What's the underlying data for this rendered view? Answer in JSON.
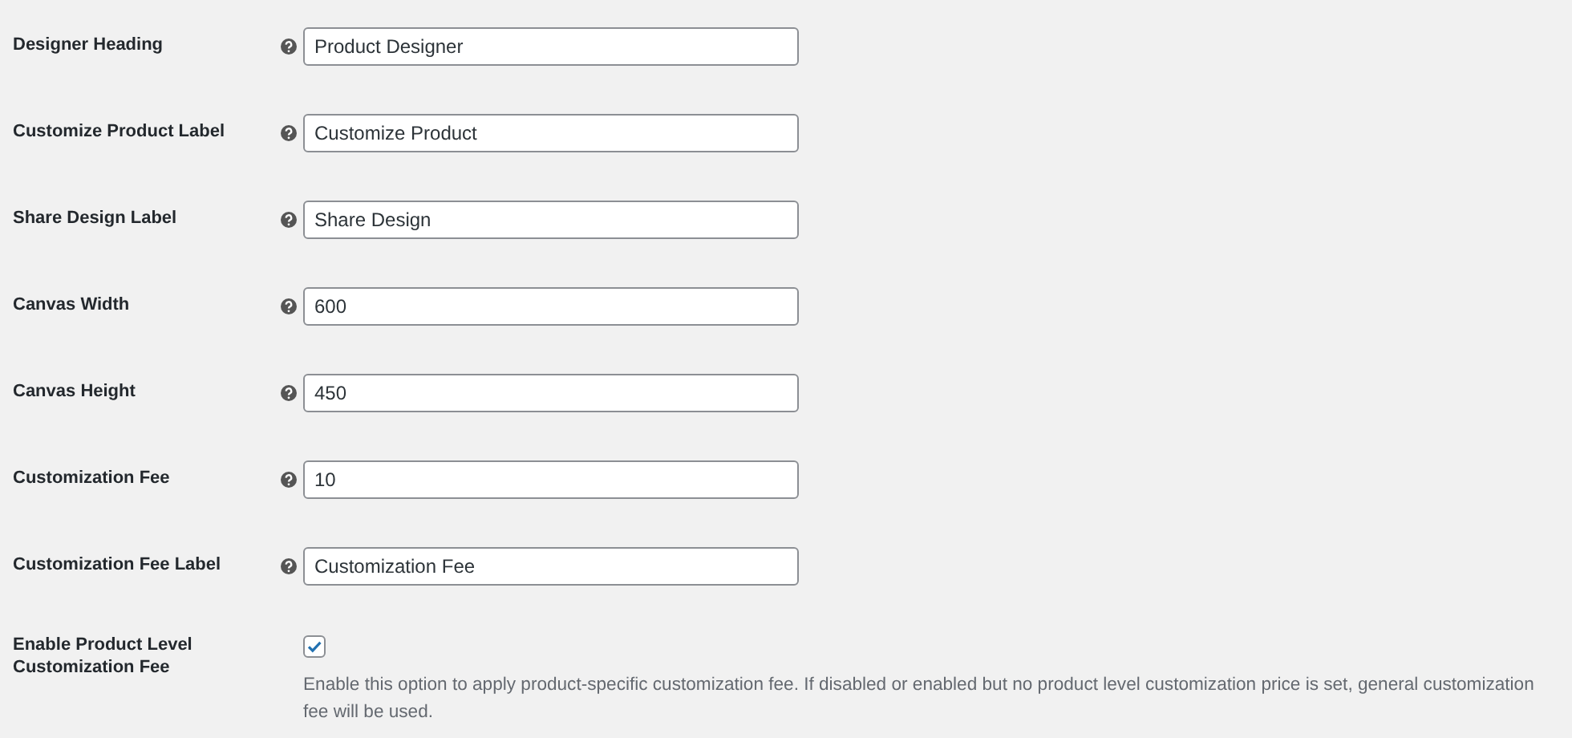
{
  "settings": [
    {
      "kind": "text",
      "label": "Designer Heading",
      "value": "Product Designer"
    },
    {
      "kind": "text",
      "label": "Customize Product Label",
      "value": "Customize Product"
    },
    {
      "kind": "text",
      "label": "Share Design Label",
      "value": "Share Design"
    },
    {
      "kind": "text",
      "label": "Canvas Width",
      "value": "600"
    },
    {
      "kind": "text",
      "label": "Canvas Height",
      "value": "450"
    },
    {
      "kind": "text",
      "label": "Customization Fee",
      "value": "10"
    },
    {
      "kind": "text",
      "label": "Customization Fee Label",
      "value": "Customization Fee"
    },
    {
      "kind": "checkbox",
      "label": "Enable Product Level Customization Fee",
      "checked": true,
      "description": "Enable this option to apply product-specific customization fee. If disabled or enabled but no product level customization price is set, general customization fee will be used."
    }
  ]
}
